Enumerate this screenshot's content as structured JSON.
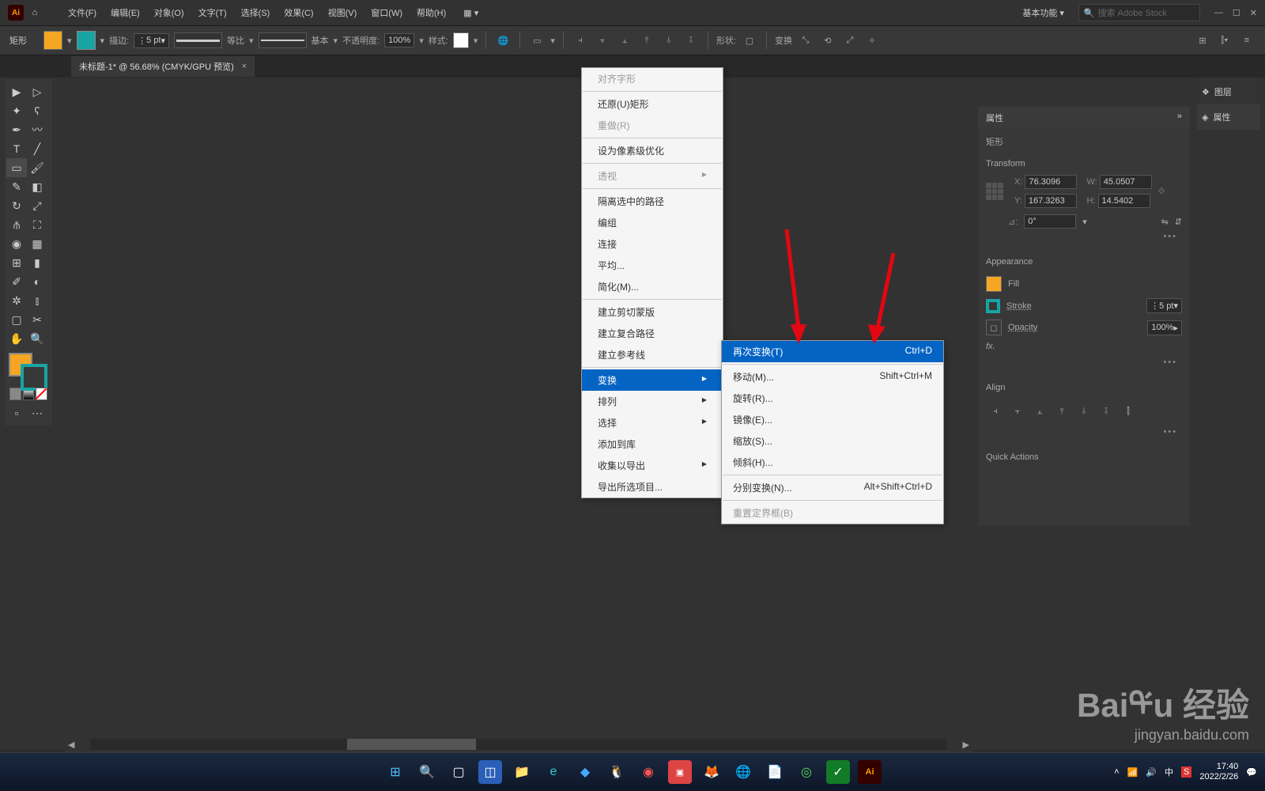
{
  "menubar": {
    "items": [
      "文件(F)",
      "编辑(E)",
      "对象(O)",
      "文字(T)",
      "选择(S)",
      "效果(C)",
      "视图(V)",
      "窗口(W)",
      "帮助(H)"
    ],
    "workspace": "基本功能",
    "search_placeholder": "搜索 Adobe Stock"
  },
  "toolbar": {
    "shape_label": "矩形",
    "stroke_label": "描边:",
    "stroke_val": "5 pt",
    "caps_label": "等比",
    "basic_label": "基本",
    "opacity_label": "不透明度:",
    "opacity_val": "100%",
    "style_label": "样式:",
    "shape2_label": "形状:",
    "transform_label": "变换"
  },
  "document": {
    "tab_title": "未标题-1* @ 56.68% (CMYK/GPU 预览)"
  },
  "context_menu": {
    "items": [
      {
        "label": "对齐字形",
        "disabled": true
      },
      {
        "sep": true
      },
      {
        "label": "还原(U)矩形"
      },
      {
        "label": "重做(R)",
        "disabled": true
      },
      {
        "sep": true
      },
      {
        "label": "设为像素级优化"
      },
      {
        "sep": true
      },
      {
        "label": "透视",
        "disabled": true,
        "sub": true
      },
      {
        "sep": true
      },
      {
        "label": "隔离选中的路径"
      },
      {
        "label": "编组"
      },
      {
        "label": "连接"
      },
      {
        "label": "平均..."
      },
      {
        "label": "简化(M)..."
      },
      {
        "sep": true
      },
      {
        "label": "建立剪切蒙版"
      },
      {
        "label": "建立复合路径"
      },
      {
        "label": "建立参考线"
      },
      {
        "sep": true
      },
      {
        "label": "变换",
        "highlight": true,
        "sub": true
      },
      {
        "label": "排列",
        "sub": true
      },
      {
        "label": "选择",
        "sub": true
      },
      {
        "label": "添加到库"
      },
      {
        "label": "收集以导出",
        "sub": true
      },
      {
        "label": "导出所选项目..."
      }
    ]
  },
  "submenu": {
    "items": [
      {
        "label": "再次变换(T)",
        "shortcut": "Ctrl+D",
        "highlight": true
      },
      {
        "sep": true
      },
      {
        "label": "移动(M)...",
        "shortcut": "Shift+Ctrl+M"
      },
      {
        "label": "旋转(R)..."
      },
      {
        "label": "镜像(E)..."
      },
      {
        "label": "缩放(S)..."
      },
      {
        "label": "倾斜(H)..."
      },
      {
        "sep": true
      },
      {
        "label": "分别变换(N)...",
        "shortcut": "Alt+Shift+Ctrl+D"
      },
      {
        "sep": true
      },
      {
        "label": "重置定界框(B)",
        "disabled": true
      }
    ]
  },
  "properties": {
    "header": "属性",
    "shape_type": "矩形",
    "transform_title": "Transform",
    "x_label": "X:",
    "x_val": "76.3096",
    "y_label": "Y:",
    "y_val": "167.3263",
    "w_label": "W:",
    "w_val": "45.0507",
    "h_label": "H:",
    "h_val": "14.5402",
    "angle_label": "⊿:",
    "angle_val": "0°",
    "appearance_title": "Appearance",
    "fill_label": "Fill",
    "stroke_label": "Stroke",
    "stroke_val": "5 pt",
    "opacity_label": "Opacity",
    "opacity_val": "100%",
    "fx_label": "fx.",
    "align_title": "Align",
    "quick_title": "Quick Actions"
  },
  "dock": {
    "layers": "图层",
    "properties": "属性"
  },
  "status": {
    "zoom": "56.68%",
    "shape": "矩形"
  },
  "tray": {
    "ime": "中",
    "time": "17:40",
    "date": "2022/2/26"
  },
  "watermark": {
    "main": "Baiᡩu 经验",
    "sub": "jingyan.baidu.com"
  }
}
